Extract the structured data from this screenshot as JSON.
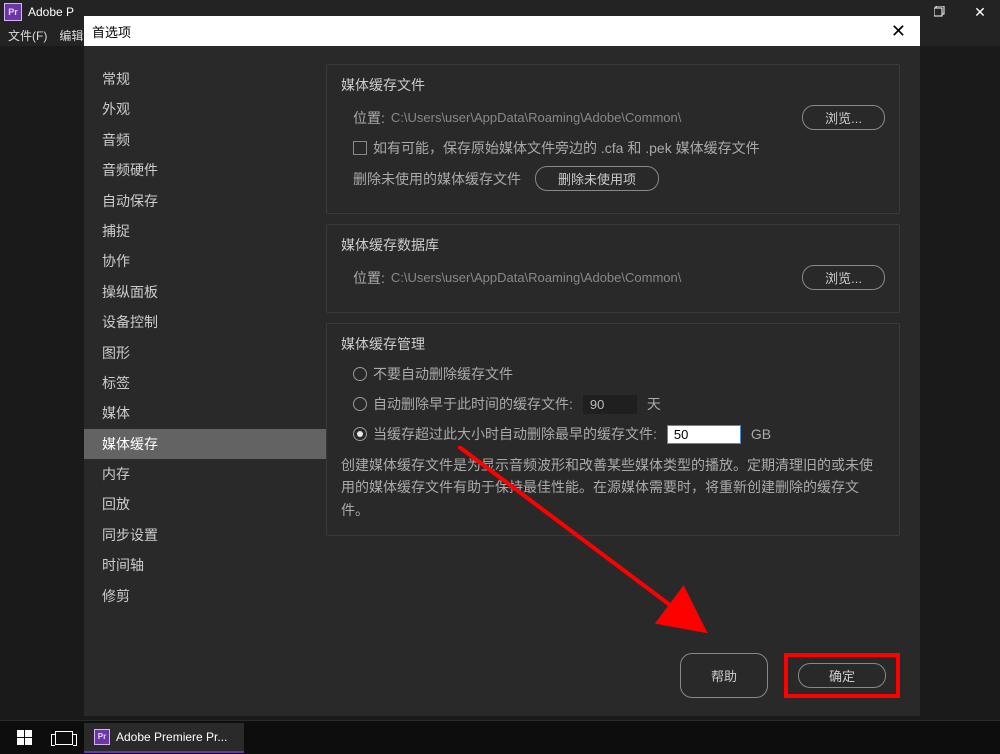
{
  "app": {
    "titlebar": "Adobe P",
    "menu": {
      "file": "文件(F)",
      "edit": "编辑"
    }
  },
  "dialog": {
    "title": "首选项",
    "sidebar": {
      "items": [
        "常规",
        "外观",
        "音频",
        "音频硬件",
        "自动保存",
        "捕捉",
        "协作",
        "操纵面板",
        "设备控制",
        "图形",
        "标签",
        "媒体",
        "媒体缓存",
        "内存",
        "回放",
        "同步设置",
        "时间轴",
        "修剪"
      ],
      "activeIndex": 12
    },
    "section1": {
      "title": "媒体缓存文件",
      "locationLabel": "位置:",
      "locationPath": "C:\\Users\\user\\AppData\\Roaming\\Adobe\\Common\\",
      "browse": "浏览...",
      "checkboxLabel": "如有可能，保存原始媒体文件旁边的 .cfa 和 .pek 媒体缓存文件",
      "deleteUnusedLabel": "删除未使用的媒体缓存文件",
      "deleteUnusedBtn": "删除未使用项"
    },
    "section2": {
      "title": "媒体缓存数据库",
      "locationLabel": "位置:",
      "locationPath": "C:\\Users\\user\\AppData\\Roaming\\Adobe\\Common\\",
      "browse": "浏览..."
    },
    "section3": {
      "title": "媒体缓存管理",
      "radio1": "不要自动删除缓存文件",
      "radio2": "自动删除早于此时间的缓存文件:",
      "radio2Value": "90",
      "radio2Unit": "天",
      "radio3": "当缓存超过此大小时自动删除最早的缓存文件:",
      "radio3Value": "50",
      "radio3Unit": "GB",
      "helpText": "创建媒体缓存文件是为显示音频波形和改善某些媒体类型的播放。定期清理旧的或未使用的媒体缓存文件有助于保持最佳性能。在源媒体需要时，将重新创建删除的缓存文件。"
    },
    "footer": {
      "help": "帮助",
      "ok": "确定"
    }
  },
  "taskbar": {
    "app": "Adobe Premiere Pr..."
  }
}
